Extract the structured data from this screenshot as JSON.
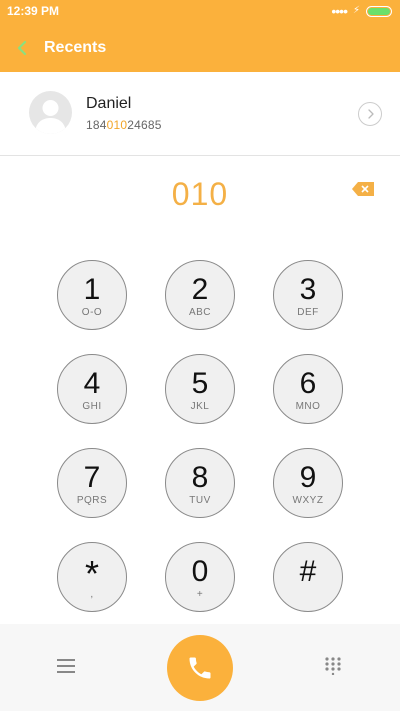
{
  "status_bar": {
    "time": "12:39 PM",
    "signal_dots": "••••",
    "charging_icon": "lightning-icon",
    "battery_color": "#6be06b"
  },
  "header": {
    "title": "Recents",
    "back_icon": "chevron-left-icon",
    "color": "#fbb13c"
  },
  "contact": {
    "name": "Daniel",
    "number_prefix": "184",
    "number_match": "010",
    "number_suffix": "24685",
    "avatar_icon": "person-icon",
    "detail_icon": "chevron-right-icon"
  },
  "dialer": {
    "input": "010",
    "backspace_icon": "backspace-icon",
    "keys": [
      {
        "digit": "1",
        "letters": "O-O"
      },
      {
        "digit": "2",
        "letters": "ABC"
      },
      {
        "digit": "3",
        "letters": "DEF"
      },
      {
        "digit": "4",
        "letters": "GHI"
      },
      {
        "digit": "5",
        "letters": "JKL"
      },
      {
        "digit": "6",
        "letters": "MNO"
      },
      {
        "digit": "7",
        "letters": "PQRS"
      },
      {
        "digit": "8",
        "letters": "TUV"
      },
      {
        "digit": "9",
        "letters": "WXYZ"
      },
      {
        "digit": "*",
        "letters": ","
      },
      {
        "digit": "0",
        "letters": "+"
      },
      {
        "digit": "#",
        "letters": ""
      }
    ]
  },
  "bottom_bar": {
    "menu_icon": "menu-icon",
    "call_icon": "phone-icon",
    "keypad_icon": "keypad-icon",
    "accent": "#fbb13c"
  }
}
